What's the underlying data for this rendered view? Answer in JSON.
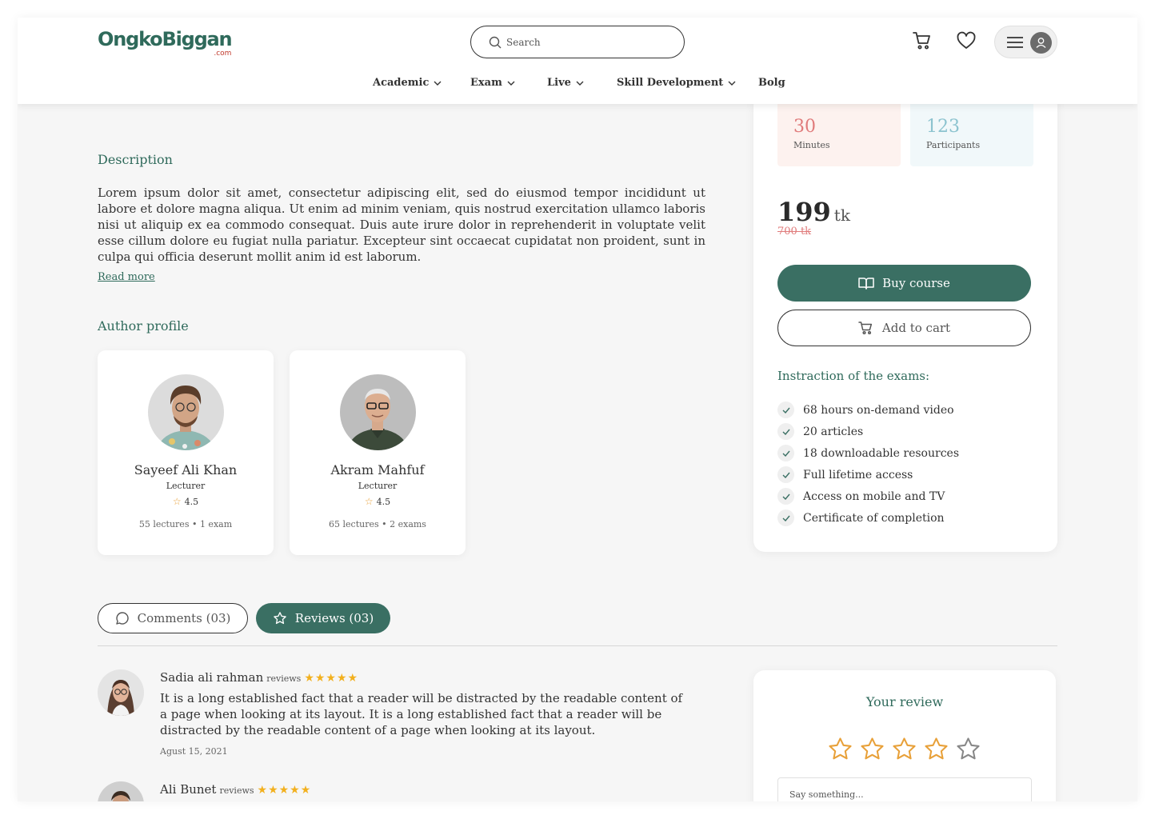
{
  "header": {
    "logo_text": "OngkoBiggan",
    "logo_suffix": ".com",
    "search_placeholder": "Search",
    "nav": [
      {
        "label": "Academic",
        "has_dropdown": true
      },
      {
        "label": "Exam",
        "has_dropdown": true
      },
      {
        "label": "Live",
        "has_dropdown": true
      },
      {
        "label": "Skill Development",
        "has_dropdown": true
      },
      {
        "label": "Bolg",
        "has_dropdown": false
      }
    ],
    "icons": [
      "cart-icon",
      "heart-icon",
      "menu-icon",
      "user-icon"
    ]
  },
  "description": {
    "heading": "Description",
    "text": "Lorem ipsum dolor sit amet, consectetur adipiscing elit, sed do eiusmod tempor incididunt ut labore et dolore magna aliqua. Ut enim ad minim veniam, quis nostrud exercitation ullamco laboris nisi ut aliquip ex ea commodo consequat. Duis aute irure dolor in reprehenderit in voluptate velit esse cillum dolore eu fugiat nulla pariatur. Excepteur sint occaecat cupidatat non proident, sunt in culpa qui officia deserunt mollit anim id est laborum.",
    "read_more": "Read more"
  },
  "authors": {
    "heading": "Author profile",
    "items": [
      {
        "name": "Sayeef Ali Khan",
        "role": "Lecturer",
        "rating": "4.5",
        "meta": "55 lectures • 1 exam"
      },
      {
        "name": "Akram Mahfuf",
        "role": "Lecturer",
        "rating": "4.5",
        "meta": "65 lectures • 2 exams"
      }
    ]
  },
  "course_card": {
    "stats": [
      {
        "value": "30",
        "label": "Minutes",
        "color": "#e07b7b",
        "bg": "#fdf2ef"
      },
      {
        "value": "123",
        "label": "Participants",
        "color": "#8cc3cf",
        "bg": "#f1f8fa"
      }
    ],
    "price": "199",
    "currency": "tk",
    "old_price": "700 tk",
    "buy_label": "Buy course",
    "cart_label": "Add to cart",
    "instructions_title": "Instraction of the exams:",
    "features": [
      "68 hours on-demand video",
      "20 articles",
      "18 downloadable resources",
      "Full lifetime access",
      "Access on mobile and TV",
      "Certificate of completion"
    ]
  },
  "tabs": {
    "comments": "Comments (03)",
    "reviews": "Reviews (03)",
    "active": "reviews"
  },
  "reviews": [
    {
      "name": "Sadia ali rahman",
      "tag": "reviews",
      "rating": 5,
      "text": "It is a long established fact that a reader will be distracted by the readable content of a page when looking at its layout. It is a long established fact that a reader will be distracted by the readable content of a page when looking at its layout.",
      "date": "Agust 15, 2021"
    },
    {
      "name": "Ali Bunet",
      "tag": "reviews",
      "rating": 5
    }
  ],
  "your_review": {
    "title": "Your review",
    "filled_stars": 4,
    "total_stars": 5,
    "placeholder": "Say something..."
  },
  "colors": {
    "brand": "#2f6a5b",
    "primary_button": "#3a6f63",
    "star": "#f2b01e",
    "star_outline": "#e8a13a"
  }
}
